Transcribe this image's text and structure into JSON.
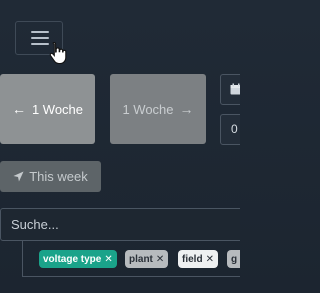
{
  "header": {
    "menu_icon": "hamburger-icon",
    "cursor_icon": "hand-pointer-icon"
  },
  "week_nav": {
    "prev_label": "1 Woche",
    "prev_icon": "arrow-left-icon",
    "next_label": "1 Woche",
    "next_icon": "arrow-right-icon",
    "this_week_label": "This week",
    "this_week_icon": "location-arrow-icon"
  },
  "date_picker": {
    "calendar_icon": "calendar-icon",
    "date_value": "0"
  },
  "search": {
    "placeholder": "Suche..."
  },
  "filters": {
    "tags": [
      {
        "label": "voltage type",
        "remove_icon": "close-icon",
        "color": "#1aa38a"
      },
      {
        "label": "plant",
        "remove_icon": "close-icon",
        "color": "#b7bbbe"
      },
      {
        "label": "field",
        "remove_icon": "close-icon",
        "color": "#eef0f1"
      },
      {
        "label": "g",
        "remove_icon": "close-icon",
        "color": "#b7bbbe"
      }
    ]
  },
  "colors": {
    "background": "#1f2833",
    "accent_green": "#1aa38a"
  }
}
